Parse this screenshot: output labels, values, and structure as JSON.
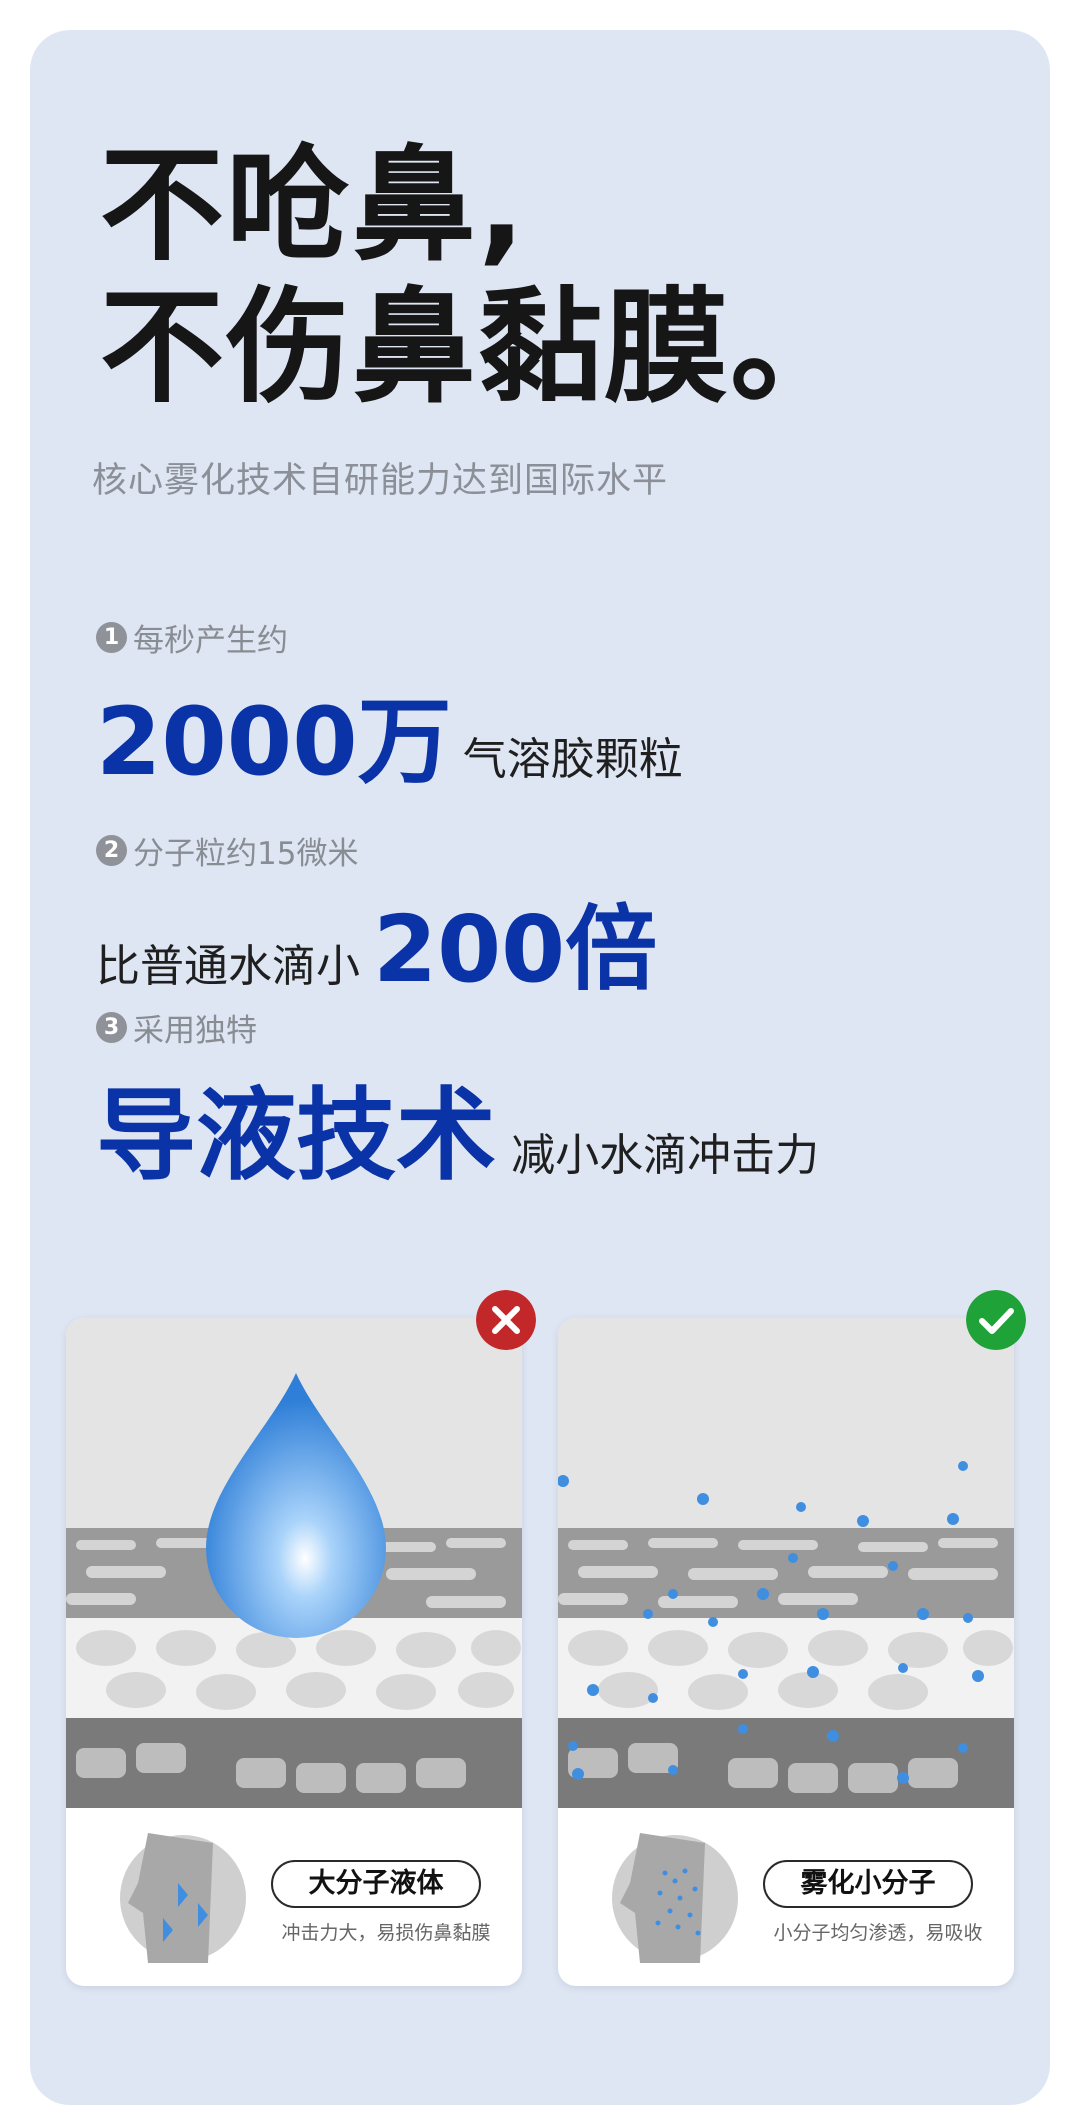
{
  "headline": {
    "line1": "不呛鼻,",
    "line2": "不伤鼻黏膜。"
  },
  "subtitle": "核心雾化技术自研能力达到国际水平",
  "points": [
    {
      "num": "1",
      "label": "每秒产生约",
      "highlight": "2000万",
      "suffix": "气溶胶颗粒"
    },
    {
      "num": "2",
      "label": "分子粒约15微米",
      "prefix": "比普通水滴小",
      "highlight": "200倍"
    },
    {
      "num": "3",
      "label": "采用独特",
      "highlight": "导液技术",
      "suffix": "减小水滴冲击力"
    }
  ],
  "cards": [
    {
      "status": "wrong",
      "title": "大分子液体",
      "description": "冲击力大，易损伤鼻黏膜",
      "badge_color": "#c2282a"
    },
    {
      "status": "correct",
      "title": "雾化小分子",
      "description": "小分子均匀渗透，易吸收",
      "badge_color": "#1fa339"
    }
  ],
  "colors": {
    "background": "#dfe6f3",
    "accent_blue": "#0a33a8",
    "droplet_blue": "#3f8ee0"
  }
}
